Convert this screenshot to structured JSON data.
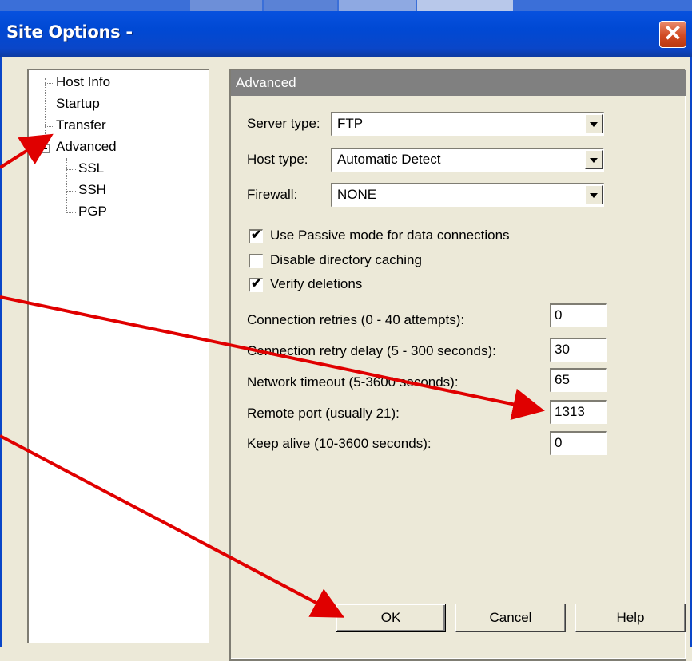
{
  "window": {
    "title": "Site Options -"
  },
  "tree": {
    "items": [
      {
        "label": "Host Info"
      },
      {
        "label": "Startup"
      },
      {
        "label": "Transfer"
      },
      {
        "label": "Advanced"
      },
      {
        "label": "SSL"
      },
      {
        "label": "SSH"
      },
      {
        "label": "PGP"
      }
    ]
  },
  "advanced": {
    "header": "Advanced",
    "server_type": {
      "label": "Server type:",
      "value": "FTP"
    },
    "host_type": {
      "label": "Host type:",
      "value": "Automatic Detect"
    },
    "firewall": {
      "label": "Firewall:",
      "value": "NONE"
    },
    "checks": [
      {
        "label": "Use Passive mode for data connections",
        "checked": true,
        "mark": "✔"
      },
      {
        "label": "Disable directory caching",
        "checked": false,
        "mark": ""
      },
      {
        "label": "Verify deletions",
        "checked": true,
        "mark": "✔"
      }
    ],
    "fields": [
      {
        "label": "Connection retries (0 - 40 attempts):",
        "value": "0"
      },
      {
        "label": "Connection retry delay (5 - 300 seconds):",
        "value": "30"
      },
      {
        "label": "Network timeout (5-3600 seconds):",
        "value": "65"
      },
      {
        "label": "Remote port (usually 21):",
        "value": "1313"
      },
      {
        "label": "Keep alive (10-3600 seconds):",
        "value": "0"
      }
    ]
  },
  "buttons": {
    "ok": "OK",
    "cancel": "Cancel",
    "help": "Help"
  },
  "colors": {
    "annotation_arrow": "#e00000",
    "titlebar": "#0049d4"
  }
}
